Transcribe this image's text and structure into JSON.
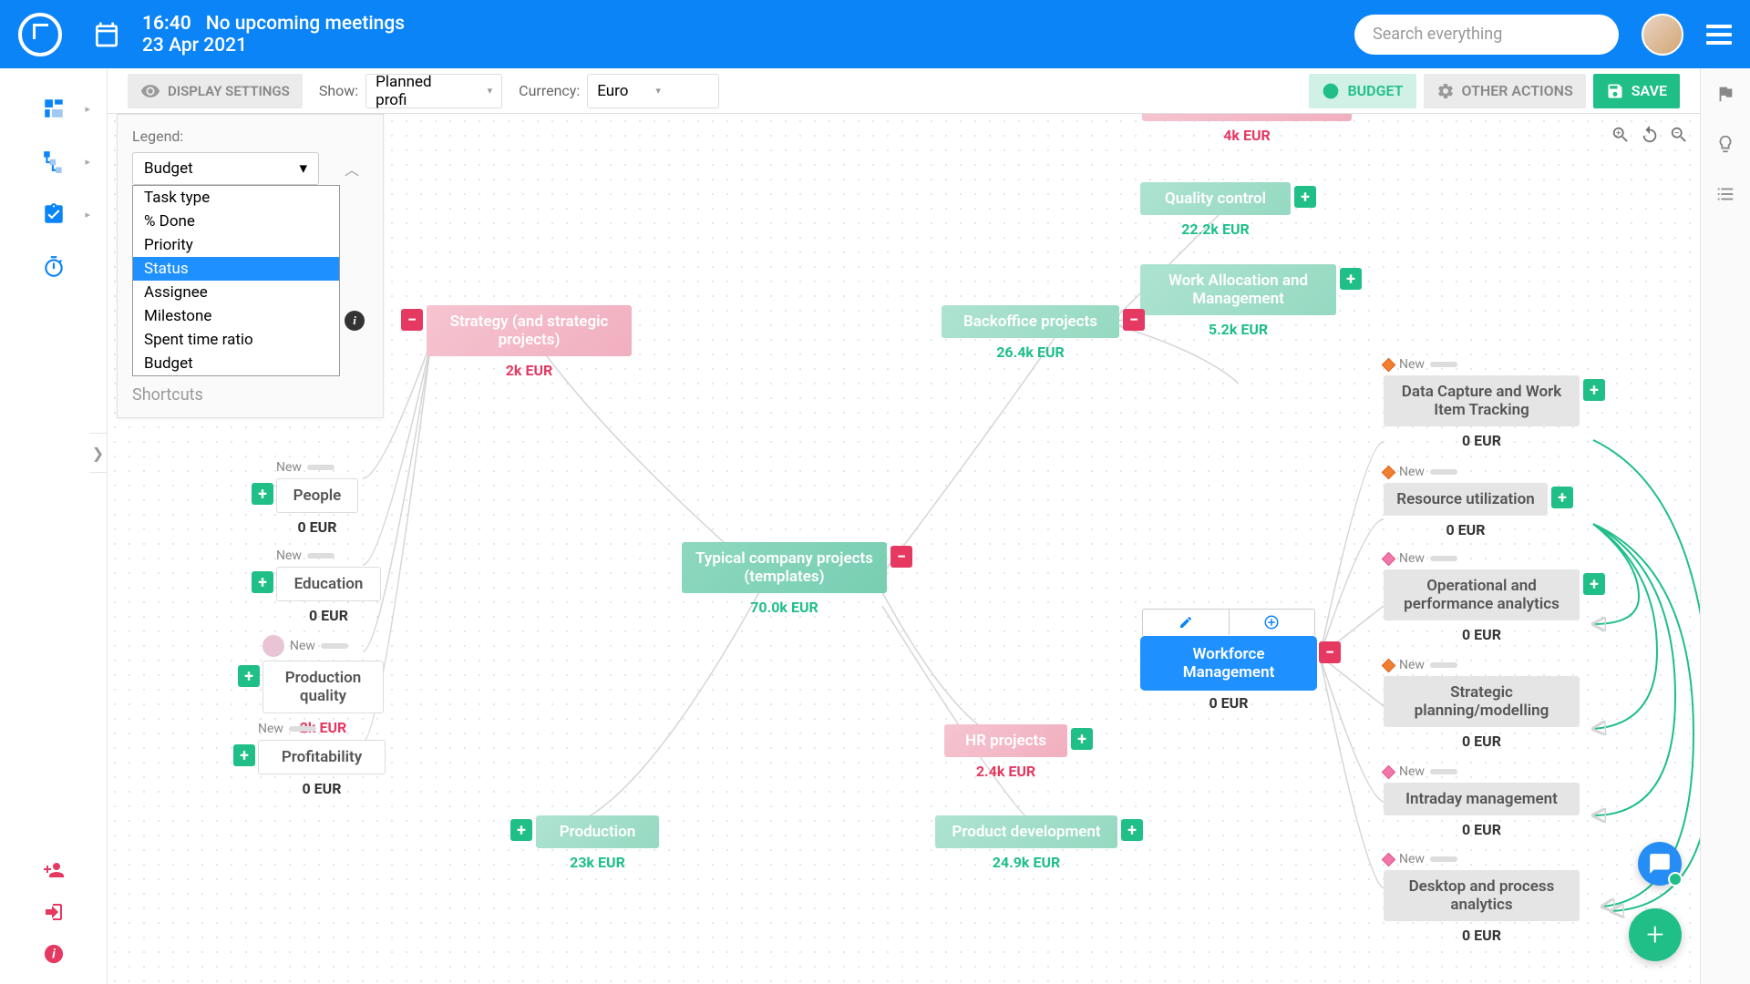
{
  "header": {
    "time": "16:40",
    "meeting_status": "No upcoming meetings",
    "date": "23 Apr 2021",
    "search_placeholder": "Search everything"
  },
  "toolbar": {
    "display_settings": "DISPLAY SETTINGS",
    "show_label": "Show:",
    "show_value": "Planned profi",
    "currency_label": "Currency:",
    "currency_value": "Euro",
    "budget_btn": "BUDGET",
    "other_btn": "OTHER ACTIONS",
    "save_btn": "SAVE"
  },
  "legend": {
    "label": "Legend:",
    "value": "Budget",
    "options": [
      "Task type",
      "% Done",
      "Priority",
      "Status",
      "Assignee",
      "Milestone",
      "Spent time ratio",
      "Budget"
    ],
    "selected_index": 3,
    "shortcuts": "Shortcuts"
  },
  "nodes": {
    "center": {
      "label": "Typical company projects (templates)",
      "value": "70.0k EUR"
    },
    "strategy": {
      "label": "Strategy (and strategic projects)",
      "value": "2k EUR"
    },
    "backoffice": {
      "label": "Backoffice projects",
      "value": "26.4k EUR"
    },
    "hr": {
      "label": "HR projects",
      "value": "2.4k EUR"
    },
    "product_dev": {
      "label": "Product development",
      "value": "24.9k EUR"
    },
    "production_main": {
      "label": "Production",
      "value": "23k EUR"
    },
    "quality_control": {
      "label": "Quality control",
      "value": "22.2k EUR"
    },
    "work_alloc": {
      "label": "Work Allocation and Management",
      "value": "5.2k EUR"
    },
    "top_cut": {
      "value": "4k EUR"
    },
    "workforce": {
      "label": "Workforce Management",
      "value": "0 EUR"
    },
    "people": {
      "label": "People",
      "value": "0 EUR",
      "status": "New"
    },
    "education": {
      "label": "Education",
      "value": "0 EUR",
      "status": "New"
    },
    "prod_quality": {
      "label": "Production quality",
      "value": "2k EUR",
      "status": "New"
    },
    "profitability": {
      "label": "Profitability",
      "value": "0 EUR",
      "status": "New"
    },
    "data_capture": {
      "label": "Data Capture and Work Item Tracking",
      "value": "0 EUR",
      "status": "New"
    },
    "resource_util": {
      "label": "Resource utilization",
      "value": "0 EUR",
      "status": "New"
    },
    "op_analytics": {
      "label": "Operational and performance analytics",
      "value": "0 EUR",
      "status": "New"
    },
    "strategic_plan": {
      "label": "Strategic planning/modelling",
      "value": "0 EUR",
      "status": "New"
    },
    "intraday": {
      "label": "Intraday management",
      "value": "0 EUR",
      "status": "New"
    },
    "desktop": {
      "label": "Desktop and process analytics",
      "value": "0 EUR",
      "status": "New"
    }
  }
}
